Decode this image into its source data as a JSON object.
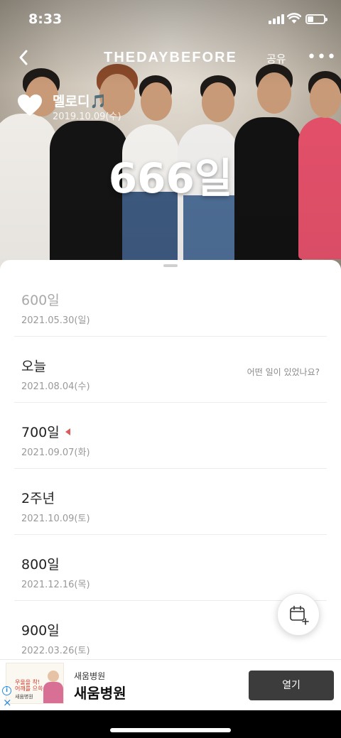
{
  "status_bar": {
    "time": "8:33"
  },
  "nav": {
    "back_icon": "chevron-left-icon",
    "brand": "THEDAYBEFORE",
    "share_label": "공유",
    "more_label": "•••"
  },
  "event": {
    "name": "멜로디🎵",
    "start_date": "2019.10.09(수)",
    "count_label": "666일"
  },
  "milestones": [
    {
      "label": "600일",
      "date": "2021.05.30(일)",
      "state": "past"
    },
    {
      "label": "오늘",
      "date": "2021.08.04(수)",
      "hint": "어떤 일이 있었나요?",
      "state": "today"
    },
    {
      "label": "700일",
      "date": "2021.09.07(화)",
      "state": "next"
    },
    {
      "label": "2주년",
      "date": "2021.10.09(토)",
      "state": "future"
    },
    {
      "label": "800일",
      "date": "2021.12.16(목)",
      "state": "future"
    },
    {
      "label": "900일",
      "date": "2022.03.26(토)",
      "state": "future"
    }
  ],
  "fab": {
    "icon": "calendar-add-icon"
  },
  "ad": {
    "thumb_line1": "우울을 착!",
    "thumb_line2": "어깨를 으쓱~",
    "thumb_brand": "새움병원",
    "small_title": "새움병원",
    "big_title": "새움병원",
    "button_label": "열기",
    "info_icon": "i",
    "close_icon": "×"
  },
  "colors": {
    "marker": "#e05a5a",
    "ad_button": "#3c3c3c",
    "ad_info": "#2b8de3"
  }
}
